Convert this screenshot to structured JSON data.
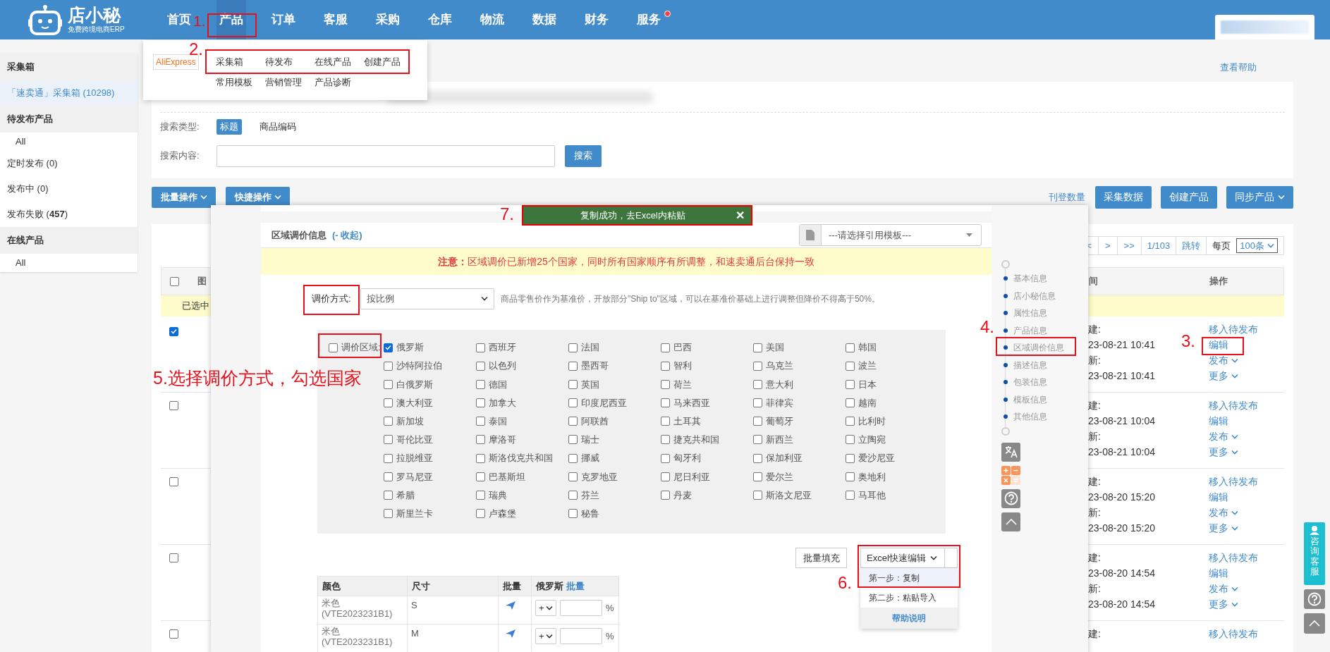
{
  "header": {
    "logo": "店小秘",
    "tagline": "免费跨境电商ERP",
    "nav": [
      {
        "label": "首页",
        "selected": false,
        "dot": false
      },
      {
        "label": "产品",
        "selected": true,
        "dot": false
      },
      {
        "label": "订单",
        "selected": false,
        "dot": false
      },
      {
        "label": "客服",
        "selected": false,
        "dot": false
      },
      {
        "label": "采购",
        "selected": false,
        "dot": false
      },
      {
        "label": "仓库",
        "selected": false,
        "dot": false
      },
      {
        "label": "物流",
        "selected": false,
        "dot": false
      },
      {
        "label": "数据",
        "selected": false,
        "dot": false
      },
      {
        "label": "财务",
        "selected": false,
        "dot": false
      },
      {
        "label": "服务",
        "selected": false,
        "dot": true
      }
    ]
  },
  "product_menu": {
    "platform": "AliExpress",
    "rows": [
      [
        "采集箱",
        "待发布",
        "在线产品",
        "创建产品"
      ],
      [
        "常用模板",
        "营销管理",
        "产品诊断"
      ]
    ]
  },
  "sidebar": [
    {
      "title": "采集箱",
      "items": [
        {
          "label": "「速卖通」采集箱 (10298)",
          "kind": "link",
          "selected": true
        }
      ]
    },
    {
      "title": "待发布产品",
      "items": [
        {
          "label": "All",
          "kind": "child",
          "selected": false
        },
        {
          "label": "定时发布 (0)",
          "kind": "link",
          "selected": false
        },
        {
          "label": "发布中 (0)",
          "kind": "link",
          "selected": false
        },
        {
          "label": "发布失败 (**457**)",
          "kind": "link",
          "selected": false
        }
      ]
    },
    {
      "title": "在线产品",
      "items": [
        {
          "label": "All",
          "kind": "child",
          "selected": false
        }
      ]
    }
  ],
  "help_link": "查看帮助",
  "search": {
    "type_label": "搜索类型:",
    "types": [
      {
        "label": "标题",
        "selected": true
      },
      {
        "label": "商品编码",
        "selected": false
      }
    ],
    "content_label": "搜索内容:",
    "button": "搜索"
  },
  "toolbar": {
    "left": [
      {
        "label": "批量操作"
      },
      {
        "label": "快捷操作"
      }
    ],
    "count_link": "刊登数量",
    "right": [
      {
        "label": "采集数据",
        "caret": false
      },
      {
        "label": "创建产品",
        "caret": false
      },
      {
        "label": "同步产品",
        "caret": true
      }
    ]
  },
  "pagination": {
    "buttons": [
      "<",
      ">",
      ">>"
    ],
    "page": "1/103",
    "jump": "跳转",
    "per_page_label": "每页",
    "per_page": "100条"
  },
  "table": {
    "all_checked": false,
    "columns": [
      "图",
      "间",
      "操作"
    ],
    "selection_bar": "已选中",
    "rows": [
      {
        "selected": true,
        "lines": [
          "建:",
          "23-08-21 10:41",
          "新:",
          "23-08-21 10:41"
        ],
        "actions": [
          {
            "label": "移入待发布",
            "caret": false
          },
          {
            "label": "编辑",
            "caret": false
          },
          {
            "label": "发布",
            "caret": true
          },
          {
            "label": "更多",
            "caret": true
          }
        ]
      },
      {
        "selected": false,
        "lines": [
          "建:",
          "23-08-21 10:04",
          "新:",
          "23-08-21 10:04"
        ],
        "actions": [
          {
            "label": "移入待发布",
            "caret": false
          },
          {
            "label": "编辑",
            "caret": false
          },
          {
            "label": "发布",
            "caret": true
          },
          {
            "label": "更多",
            "caret": true
          }
        ]
      },
      {
        "selected": false,
        "lines": [
          "建:",
          "23-08-20 15:20",
          "新:",
          "23-08-20 15:20"
        ],
        "actions": [
          {
            "label": "移入待发布",
            "caret": false
          },
          {
            "label": "编辑",
            "caret": false
          },
          {
            "label": "发布",
            "caret": true
          },
          {
            "label": "更多",
            "caret": true
          }
        ]
      },
      {
        "selected": false,
        "lines": [
          "建:",
          "23-08-20 14:54",
          "新:",
          "23-08-20 14:54"
        ],
        "actions": [
          {
            "label": "移入待发布",
            "caret": false
          },
          {
            "label": "编辑",
            "caret": false
          },
          {
            "label": "发布",
            "caret": true
          },
          {
            "label": "更多",
            "caret": true
          }
        ]
      },
      {
        "selected": false,
        "lines": [
          "建:"
        ],
        "actions": [
          {
            "label": "移入待发布",
            "caret": false
          }
        ]
      }
    ]
  },
  "modal": {
    "section_title": "区域调价信息",
    "collapse_link": "(- 收起)",
    "template_placeholder": "---请选择引用模板---",
    "notice": "**注意：**区域调价已新增25个国家，同时所有国家顺序有所调整，和速卖通后台保持一致",
    "method_label": "调价方式:",
    "method_value": "按比例",
    "method_hint": "商品零售价作为基准价，开放部分\"Ship to\"区域，可以在基准价基础上进行调整但降价不得高于50%。",
    "region_label": "调价区域:",
    "region_all_checked": false,
    "countries": [
      {
        "name": "俄罗斯",
        "checked": true
      },
      {
        "name": "西班牙",
        "checked": false
      },
      {
        "name": "法国",
        "checked": false
      },
      {
        "name": "巴西",
        "checked": false
      },
      {
        "name": "美国",
        "checked": false
      },
      {
        "name": "韩国",
        "checked": false
      },
      {
        "name": "沙特阿拉伯",
        "checked": false
      },
      {
        "name": "以色列",
        "checked": false
      },
      {
        "name": "墨西哥",
        "checked": false
      },
      {
        "name": "智利",
        "checked": false
      },
      {
        "name": "乌克兰",
        "checked": false
      },
      {
        "name": "波兰",
        "checked": false
      },
      {
        "name": "白俄罗斯",
        "checked": false
      },
      {
        "name": "德国",
        "checked": false
      },
      {
        "name": "英国",
        "checked": false
      },
      {
        "name": "荷兰",
        "checked": false
      },
      {
        "name": "意大利",
        "checked": false
      },
      {
        "name": "日本",
        "checked": false
      },
      {
        "name": "澳大利亚",
        "checked": false
      },
      {
        "name": "加拿大",
        "checked": false
      },
      {
        "name": "印度尼西亚",
        "checked": false
      },
      {
        "name": "马来西亚",
        "checked": false
      },
      {
        "name": "菲律宾",
        "checked": false
      },
      {
        "name": "越南",
        "checked": false
      },
      {
        "name": "新加坡",
        "checked": false
      },
      {
        "name": "泰国",
        "checked": false
      },
      {
        "name": "阿联酋",
        "checked": false
      },
      {
        "name": "土耳其",
        "checked": false
      },
      {
        "name": "葡萄牙",
        "checked": false
      },
      {
        "name": "比利时",
        "checked": false
      },
      {
        "name": "哥伦比亚",
        "checked": false
      },
      {
        "name": "摩洛哥",
        "checked": false
      },
      {
        "name": "瑞士",
        "checked": false
      },
      {
        "name": "捷克共和国",
        "checked": false
      },
      {
        "name": "新西兰",
        "checked": false
      },
      {
        "name": "立陶宛",
        "checked": false
      },
      {
        "name": "拉脱维亚",
        "checked": false
      },
      {
        "name": "斯洛伐克共和国",
        "checked": false
      },
      {
        "name": "挪威",
        "checked": false
      },
      {
        "name": "匈牙利",
        "checked": false
      },
      {
        "name": "保加利亚",
        "checked": false
      },
      {
        "name": "爱沙尼亚",
        "checked": false
      },
      {
        "name": "罗马尼亚",
        "checked": false
      },
      {
        "name": "巴基斯坦",
        "checked": false
      },
      {
        "name": "克罗地亚",
        "checked": false
      },
      {
        "name": "尼日利亚",
        "checked": false
      },
      {
        "name": "爱尔兰",
        "checked": false
      },
      {
        "name": "奥地利",
        "checked": false
      },
      {
        "name": "希腊",
        "checked": false
      },
      {
        "name": "瑞典",
        "checked": false
      },
      {
        "name": "芬兰",
        "checked": false
      },
      {
        "name": "丹麦",
        "checked": false
      },
      {
        "name": "斯洛文尼亚",
        "checked": false
      },
      {
        "name": "马耳他",
        "checked": false
      },
      {
        "name": "斯里兰卡",
        "checked": false
      },
      {
        "name": "卢森堡",
        "checked": false
      },
      {
        "name": "秘鲁",
        "checked": false
      }
    ],
    "bulk_fill": "批量填充",
    "excel_button": "Excel快速编辑",
    "excel_menu": [
      {
        "label": "第一步：复制",
        "selected": true
      },
      {
        "label": "第二步：粘贴导入",
        "selected": false
      }
    ],
    "excel_help": "帮助说明",
    "variant_table": {
      "columns": [
        "颜色",
        "尺寸",
        "批量",
        "俄罗斯"
      ],
      "column_link": "批量",
      "rows": [
        {
          "color_name": "米色",
          "sku": "(VTE2023231B1)",
          "size": "S",
          "op": "+",
          "unit": "%"
        },
        {
          "color_name": "米色",
          "sku": "(VTE2023231B1)",
          "size": "M",
          "op": "+",
          "unit": "%"
        }
      ]
    },
    "nav": [
      "基本信息",
      "店小秘信息",
      "属性信息",
      "产品信息",
      "区域调价信息",
      "描述信息",
      "包装信息",
      "模板信息",
      "其他信息"
    ]
  },
  "toast": {
    "message": "复制成功，去Excel内粘贴",
    "close": "✕"
  },
  "annotations": [
    "1.",
    "2.",
    "3.",
    "4.",
    "5.选择调价方式，勾选国家",
    "6.",
    "7."
  ],
  "support": {
    "label": "咨询客服"
  }
}
